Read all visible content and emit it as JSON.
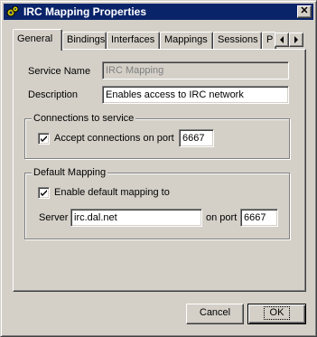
{
  "window": {
    "title": "IRC Mapping Properties",
    "title_icon": "gears-icon",
    "close_glyph": "✕"
  },
  "tabs": [
    {
      "label": "General",
      "active": true
    },
    {
      "label": "Bindings"
    },
    {
      "label": "Interfaces"
    },
    {
      "label": "Mappings"
    },
    {
      "label": "Sessions"
    },
    {
      "label": "P"
    }
  ],
  "general": {
    "service_name_label": "Service Name",
    "service_name_value": "IRC Mapping",
    "description_label": "Description",
    "description_value": "Enables access to IRC network"
  },
  "connections": {
    "group_title": "Connections to service",
    "accept_label": "Accept connections on port",
    "accept_checked": true,
    "port_value": "6667"
  },
  "default_mapping": {
    "group_title": "Default Mapping",
    "enable_label": "Enable default mapping to",
    "enable_checked": true,
    "server_label": "Server",
    "server_value": "irc.dal.net",
    "on_port_label": "on port",
    "port_value": "6667"
  },
  "buttons": {
    "cancel": "Cancel",
    "ok": "OK"
  },
  "colors": {
    "titlebar": "#0a246a",
    "face": "#d4d0c8"
  }
}
